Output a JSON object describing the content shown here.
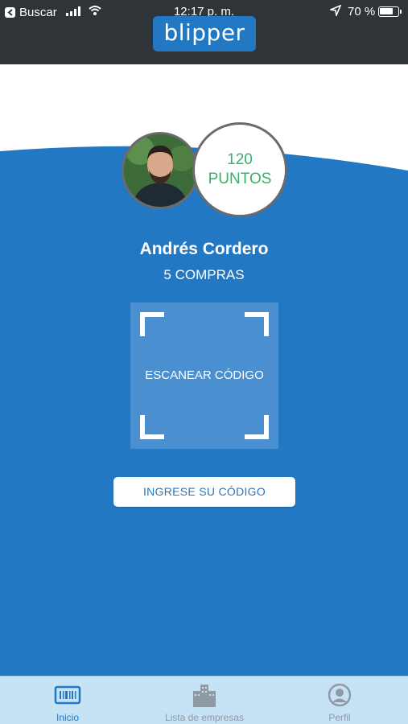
{
  "status_bar": {
    "back_label": "Buscar",
    "time": "12:17 p. m.",
    "battery": "70 %"
  },
  "header": {
    "logo": "blipper"
  },
  "profile": {
    "points_value": "120",
    "points_label": "PUNTOS",
    "name": "Andrés Cordero",
    "purchases": "5 COMPRAS"
  },
  "scan": {
    "label": "ESCANEAR CÓDIGO"
  },
  "code_button": {
    "label": "INGRESE SU CÓDIGO"
  },
  "tabs": [
    {
      "label": "Inicio",
      "icon": "barcode-icon",
      "active": true
    },
    {
      "label": "Lista de empresas",
      "icon": "buildings-icon",
      "active": false
    },
    {
      "label": "Perfil",
      "icon": "user-icon",
      "active": false
    }
  ],
  "colors": {
    "accent": "#2378c3",
    "points": "#34b36a",
    "dark_header": "#2e3438",
    "tab_bar": "#c6e2f5"
  }
}
